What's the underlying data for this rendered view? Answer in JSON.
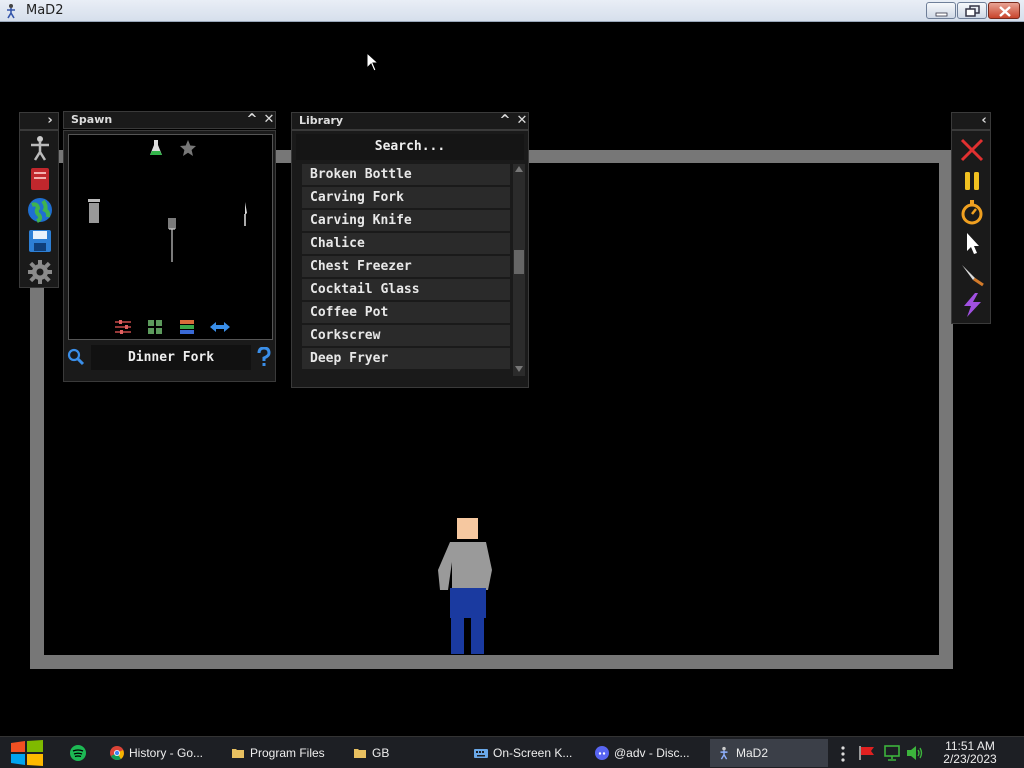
{
  "window": {
    "title": "MaD2",
    "icons": {
      "app": "mad2-app-icon",
      "minimize": "minimize-icon",
      "maximize": "maximize-icon",
      "close": "close-icon"
    }
  },
  "left_toolbar": {
    "items": [
      {
        "icon": "ragdoll-figure-icon"
      },
      {
        "icon": "red-book-icon"
      },
      {
        "icon": "globe-icon"
      },
      {
        "icon": "floppy-save-icon"
      },
      {
        "icon": "gear-icon"
      }
    ]
  },
  "spawn": {
    "title": "Spawn",
    "selected_name": "Dinner Fork",
    "top_icons": [
      "flask-icon",
      "star-icon"
    ],
    "bottom_icons": [
      "sliders-icon",
      "grid-icon",
      "stack-icon",
      "swap-arrows-icon"
    ]
  },
  "library": {
    "title": "Library",
    "search_label": "Search...",
    "items": [
      "Broken Bottle",
      "Carving Fork",
      "Carving Knife",
      "Chalice",
      "Chest Freezer",
      "Cocktail Glass",
      "Coffee Pot",
      "Corkscrew",
      "Deep Fryer"
    ]
  },
  "right_toolbar": {
    "items": [
      {
        "icon": "red-x-icon"
      },
      {
        "icon": "pause-icon"
      },
      {
        "icon": "stopwatch-icon"
      },
      {
        "icon": "pointer-icon"
      },
      {
        "icon": "knife-icon"
      },
      {
        "icon": "lightning-icon"
      }
    ]
  },
  "taskbar": {
    "tasks": [
      {
        "label": "History - Go...",
        "icon": "chrome-icon"
      },
      {
        "label": "Program Files",
        "icon": "folder-icon"
      },
      {
        "label": "GB",
        "icon": "folder-icon"
      },
      {
        "label": "On-Screen K...",
        "icon": "keyboard-icon"
      },
      {
        "label": "@adv - Disc...",
        "icon": "discord-icon"
      },
      {
        "label": "MaD2",
        "icon": "mad2-app-icon"
      }
    ],
    "clock_time": "11:51 AM",
    "clock_date": "2/23/2023"
  },
  "colors": {
    "arena_wall": "#777777",
    "panel_bg": "#1a1a1a",
    "shirt": "#9a9a9a",
    "pants": "#1a3aa0",
    "skin": "#f6c8a0"
  }
}
